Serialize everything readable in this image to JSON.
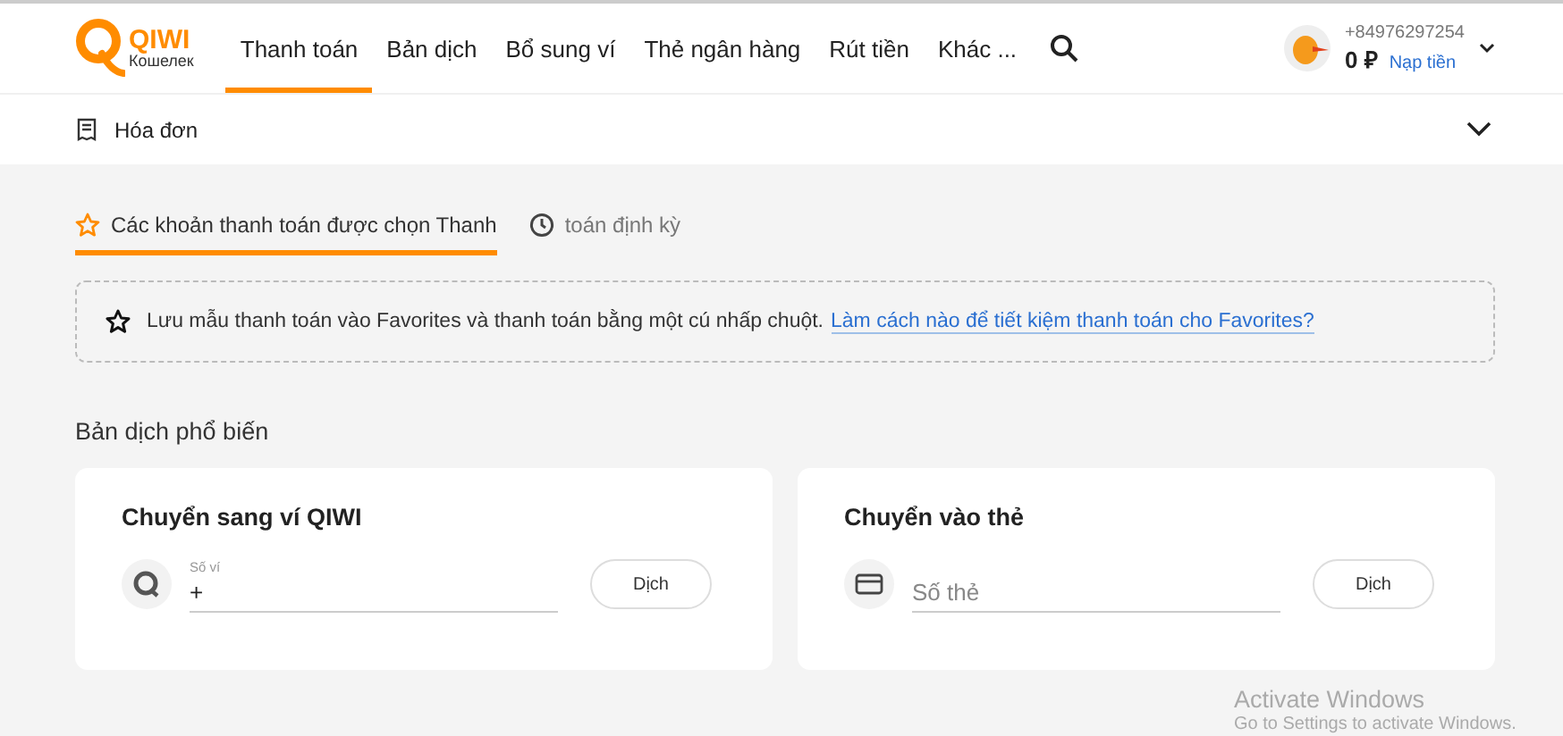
{
  "logo": {
    "name": "QIWI",
    "subtitle": "Кошелек"
  },
  "nav": [
    {
      "label": "Thanh toán",
      "selected": true
    },
    {
      "label": "Bản dịch",
      "selected": false
    },
    {
      "label": "Bổ sung ví",
      "selected": false
    },
    {
      "label": "Thẻ ngân hàng",
      "selected": false
    },
    {
      "label": "Rút tiền",
      "selected": false
    },
    {
      "label": "Khác ...",
      "selected": false
    }
  ],
  "account": {
    "phone": "+84976297254",
    "balance": "0 ₽",
    "top_up": "Nạp tiền"
  },
  "subheader": {
    "label": "Hóa đơn",
    "expanded": false
  },
  "tabs": [
    {
      "label": "Các khoản thanh toán được chọn Thanh",
      "kind": "star",
      "selected": true
    },
    {
      "label": "toán định kỳ",
      "kind": "clock",
      "selected": false
    }
  ],
  "notice": {
    "text": "Lưu mẫu thanh toán vào Favorites và thanh toán bằng một cú nhấp chuột.",
    "link": "Làm cách nào để tiết kiệm thanh toán cho Favorites?"
  },
  "section_title": "Bản dịch phổ biến",
  "cards": [
    {
      "title": "Chuyển sang ví QIWI",
      "kind": "wallet",
      "label": "Số ví",
      "value": "+",
      "button": "Dịch"
    },
    {
      "title": "Chuyển vào thẻ",
      "kind": "card",
      "placeholder": "Số thẻ",
      "button": "Dịch"
    }
  ],
  "os_notice": {
    "title": "Activate Windows",
    "text": "Go to Settings to activate Windows."
  }
}
